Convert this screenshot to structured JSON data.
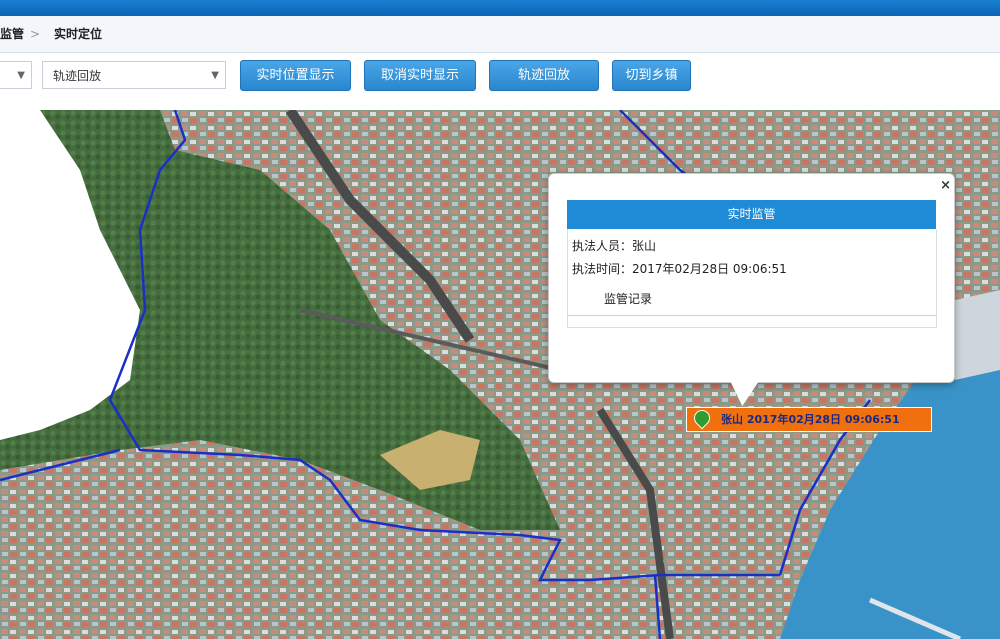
{
  "breadcrumb": {
    "parent": "监管",
    "separator": ">",
    "current": "实时定位"
  },
  "toolbar": {
    "select_first_value": "",
    "select_mode_value": "轨迹回放",
    "btn_realtime": "实时位置显示",
    "btn_cancel_realtime": "取消实时显示",
    "btn_playback": "轨迹回放",
    "btn_switch_town": "切到乡镇"
  },
  "popup": {
    "close": "×",
    "title": "实时监管",
    "officer_label": "执法人员：",
    "officer_value": "张山",
    "time_label": "执法时间：",
    "time_value": "2017年02月28日 09:06:51",
    "tab_record": "监管记录"
  },
  "marker": {
    "label": "张山  2017年02月28日 09:06:51"
  },
  "colors": {
    "accent": "#1f8ad6",
    "marker_bg": "#f07010",
    "boundary": "#1a2fc8",
    "sea": "#3a93c8"
  },
  "icons": {
    "dropdown": "chevron-down-icon",
    "close": "close-icon",
    "marker": "map-pin-icon"
  }
}
